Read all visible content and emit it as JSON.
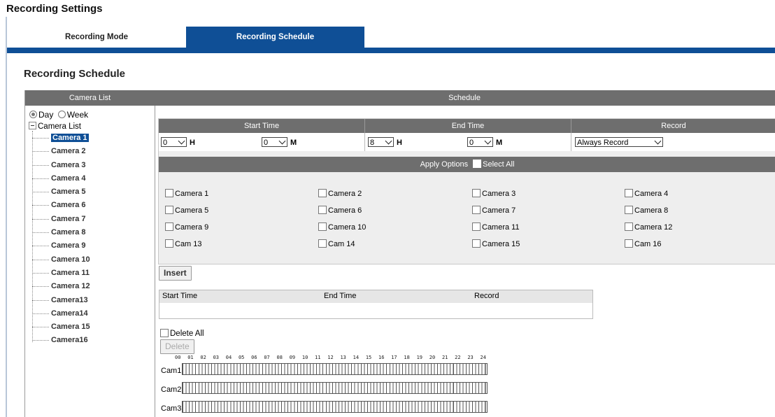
{
  "page": {
    "title": "Recording Settings"
  },
  "tabs": [
    {
      "label": "Recording Mode",
      "active": false
    },
    {
      "label": "Recording Schedule",
      "active": true
    }
  ],
  "section_title": "Recording Schedule",
  "left_panel": {
    "header": "Camera List",
    "mode": {
      "day": "Day",
      "week": "Week",
      "selected": "Day"
    },
    "tree_root": "Camera List",
    "cameras": [
      "Camera 1",
      "Camera 2",
      "Camera 3",
      "Camera 4",
      "Camera 5",
      "Camera 6",
      "Camera 7",
      "Camera 8",
      "Camera 9",
      "Camera 10",
      "Camera 11",
      "Camera 12",
      "Camera13",
      "Camera14",
      "Camera 15",
      "Camera16"
    ],
    "selected_camera": "Camera 1"
  },
  "schedule": {
    "header": "Schedule",
    "columns": {
      "start": "Start Time",
      "end": "End Time",
      "record": "Record"
    },
    "start_hour": "0",
    "start_min": "0",
    "end_hour": "8",
    "end_min": "0",
    "hour_unit": "H",
    "min_unit": "M",
    "record_value": "Always Record",
    "apply_options": "Apply Options",
    "select_all": "Select All",
    "apply_cameras": [
      "Camera 1",
      "Camera 2",
      "Camera 3",
      "Camera 4",
      "Camera 5",
      "Camera 6",
      "Camera 7",
      "Camera 8",
      "Camera 9",
      "Camera 10",
      "Camera 11",
      "Camera 12",
      "Cam 13",
      "Cam 14",
      "Camera 15",
      "Cam 16"
    ],
    "insert_label": "Insert",
    "list_headers": [
      "Start Time",
      "End Time",
      "Record"
    ],
    "delete_all_label": "Delete All",
    "delete_label": "Delete"
  },
  "timeline": {
    "hours": [
      "00",
      "01",
      "02",
      "03",
      "04",
      "05",
      "06",
      "07",
      "08",
      "09",
      "10",
      "11",
      "12",
      "13",
      "14",
      "15",
      "16",
      "17",
      "18",
      "19",
      "20",
      "21",
      "22",
      "23",
      "24"
    ],
    "rows": [
      "Cam1",
      "Cam2",
      "Cam3"
    ]
  }
}
